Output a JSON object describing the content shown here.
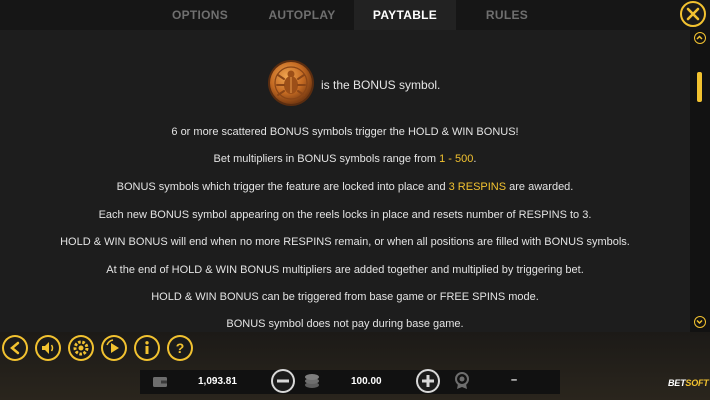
{
  "tabs": [
    {
      "label": "OPTIONS",
      "active": false
    },
    {
      "label": "AUTOPLAY",
      "active": false
    },
    {
      "label": "PAYTABLE",
      "active": true
    },
    {
      "label": "RULES",
      "active": false
    }
  ],
  "paytable": {
    "symbol_caption": "is the BONUS symbol.",
    "lines": [
      {
        "parts": [
          {
            "text": "6 or more scattered BONUS symbols trigger the HOLD & WIN BONUS!"
          }
        ]
      },
      {
        "parts": [
          {
            "text": "Bet multipliers in BONUS symbols range from "
          },
          {
            "text": "1 - 500",
            "highlight": true
          },
          {
            "text": "."
          }
        ]
      },
      {
        "parts": [
          {
            "text": "BONUS symbols which trigger the feature are locked into place and "
          },
          {
            "text": "3 RESPINS",
            "highlight": true
          },
          {
            "text": " are awarded."
          }
        ]
      },
      {
        "parts": [
          {
            "text": "Each new BONUS symbol appearing on the reels locks in place and resets number of RESPINS to 3."
          }
        ]
      },
      {
        "parts": [
          {
            "text": "HOLD & WIN BONUS will end when no more RESPINS remain, or when all positions are filled with BONUS symbols."
          }
        ]
      },
      {
        "parts": [
          {
            "text": "At the end of HOLD & WIN BONUS multipliers are added together and multiplied by triggering bet."
          }
        ]
      },
      {
        "parts": [
          {
            "text": "HOLD & WIN BONUS can be triggered from base game or FREE SPINS mode."
          }
        ]
      },
      {
        "parts": [
          {
            "text": "BONUS symbol does not pay during base game."
          }
        ]
      }
    ]
  },
  "controls": {
    "icons": [
      "back-icon",
      "sound-icon",
      "settings-icon",
      "spin-mode-icon",
      "play-icon",
      "info-icon",
      "help-icon"
    ]
  },
  "status": {
    "balance": "1,093.81",
    "bet": "100.00",
    "win": "–"
  },
  "brand": {
    "prefix": "BET",
    "suffix": "SOFT"
  },
  "colors": {
    "accent": "#f2c230",
    "background": "#1d1d1d",
    "text": "#e3e3e3"
  }
}
